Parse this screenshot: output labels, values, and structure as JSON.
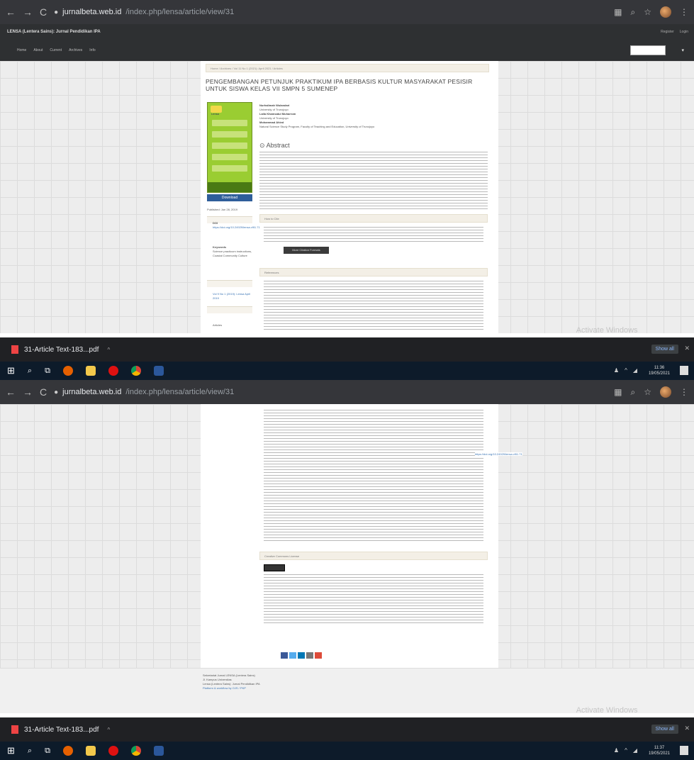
{
  "browser": {
    "nav_back": "←",
    "nav_forward": "→",
    "nav_reload": "C",
    "url_host": "jurnalbeta.web.id",
    "url_path": "/index.php/lensa/article/view/31"
  },
  "site": {
    "title": "LENSA (Lentera Sains): Jurnal Pendidikan IPA",
    "menu": [
      "Home",
      "About",
      "Current",
      "Archives",
      "Info"
    ],
    "right_links": [
      "Register",
      "Login"
    ],
    "search_button": "▾"
  },
  "article": {
    "breadcrumb": "Home / Archives / Vol 11 No 1 (2021): April 2021 / Articles",
    "title": "PENGEMBANGAN PETUNJUK PRAKTIKUM IPA BERBASIS KULTUR MASYARAKAT PESISIR UNTUK SISWA KELAS VII SMPN 5 SUMENEP",
    "cover_logo": "Lensa",
    "download_label": "Download",
    "published": "Published: Jun 28, 2019",
    "doi_label": "DOI",
    "doi_value": "https://doi.org/10.24929/lensa.v9i1.71",
    "keywords_label": "Keywords",
    "keywords_value": "Science practicum instructions, Coastal Community Culture",
    "authors": [
      {
        "name": "Nurhalimah Wulandari",
        "aff": "University of Trunojoyo"
      },
      {
        "name": "Laila Khamsatul Muharrom",
        "aff": "University of Trunojoyo"
      },
      {
        "name": "Mohammad Ahied",
        "aff": "Natural Science Study Program, Faculty of Teaching and Education, University of Trunojoyo"
      }
    ],
    "abstract_heading": "Abstract",
    "how_to_cite": "How to Cite",
    "cite_button": "More Citation Formats",
    "references": "References",
    "side_issue_label": "Issue",
    "side_issue_value": "Vol 9 No 1 (2019): Lensa April 2019",
    "side_section_label": "Section",
    "side_section_value": "Articles"
  },
  "downloads": {
    "file_name": "31-Article Text-183...pdf",
    "caret": "^",
    "show_all": "Show all",
    "close": "✕"
  },
  "watermark": {
    "line1": "Activate Windows",
    "line2": "Go to Settings to activate Windows."
  },
  "taskbar": {
    "time1": "11:36",
    "date1": "19/05/2021",
    "time2": "11:37",
    "date2": "19/05/2021"
  },
  "bottom": {
    "license_heading": "Creative Commons License",
    "footer_line1": "Sekretariat Jurnal LENSA (Lentera Sains)",
    "footer_line2": "Jl. Kampus Universitas",
    "footer_line3": "Lensa (Lentera Sains): Jurnal Pendidikan IPA",
    "footer_platform": "Platform & workflow by OJS / PKP",
    "long_url_fragment": "https://doi.org/10.24929/lensa.v9i1.71"
  }
}
